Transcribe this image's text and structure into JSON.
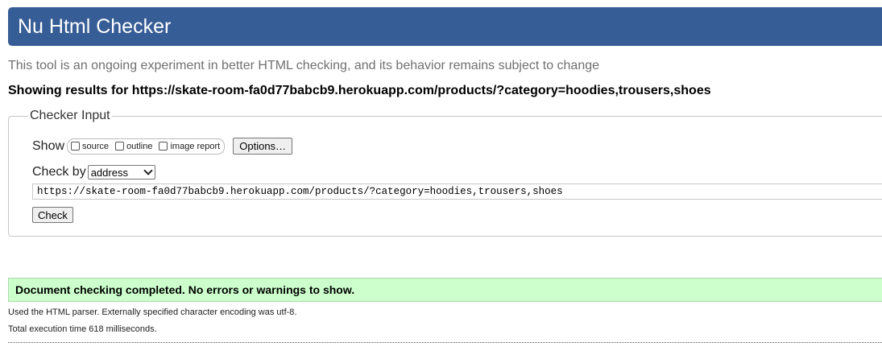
{
  "header": {
    "title": "Nu Html Checker",
    "background": "#365d95"
  },
  "subtitle": "This tool is an ongoing experiment in better HTML checking, and its behavior remains subject to change",
  "results_for": "Showing results for https://skate-room-fa0d77babcb9.herokuapp.com/products/?category=hoodies,trousers,shoes",
  "checker_input": {
    "legend": "Checker Input",
    "show_label": "Show",
    "show_options": [
      {
        "label": "source",
        "checked": false
      },
      {
        "label": "outline",
        "checked": false
      },
      {
        "label": "image report",
        "checked": false
      }
    ],
    "options_button": "Options…",
    "check_by_label": "Check by",
    "check_by_value": "address",
    "url_value": "https://skate-room-fa0d77babcb9.herokuapp.com/products/?category=hoodies,trousers,shoes",
    "check_button": "Check"
  },
  "result": {
    "message": "Document checking completed. No errors or warnings to show.",
    "background": "#ccffcc"
  },
  "info": {
    "parser": "Used the HTML parser. Externally specified character encoding was utf-8.",
    "time": "Total execution time 618 milliseconds."
  }
}
